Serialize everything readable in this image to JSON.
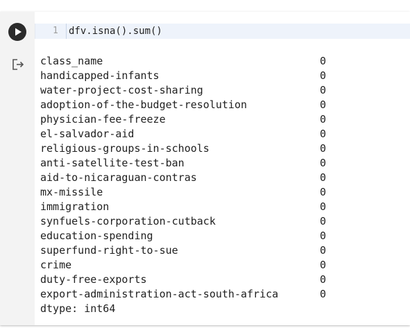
{
  "code_cell": {
    "line_number": "1",
    "code": "dfv.isna().sum()",
    "run_button_icon": "play-icon"
  },
  "output": {
    "icon": "output-redirect-icon",
    "rows": [
      {
        "name": "class_name",
        "value": "0"
      },
      {
        "name": "handicapped-infants",
        "value": "0"
      },
      {
        "name": "water-project-cost-sharing",
        "value": "0"
      },
      {
        "name": "adoption-of-the-budget-resolution",
        "value": "0"
      },
      {
        "name": "physician-fee-freeze",
        "value": "0"
      },
      {
        "name": "el-salvador-aid",
        "value": "0"
      },
      {
        "name": "religious-groups-in-schools",
        "value": "0"
      },
      {
        "name": "anti-satellite-test-ban",
        "value": "0"
      },
      {
        "name": "aid-to-nicaraguan-contras",
        "value": "0"
      },
      {
        "name": "mx-missile",
        "value": "0"
      },
      {
        "name": "immigration",
        "value": "0"
      },
      {
        "name": "synfuels-corporation-cutback",
        "value": "0"
      },
      {
        "name": "education-spending",
        "value": "0"
      },
      {
        "name": "superfund-right-to-sue",
        "value": "0"
      },
      {
        "name": "crime",
        "value": "0"
      },
      {
        "name": "duty-free-exports",
        "value": "0"
      },
      {
        "name": "export-administration-act-south-africa",
        "value": "0"
      }
    ],
    "dtype_line": "dtype: int64"
  },
  "colors": {
    "code_background": "#eef3fb",
    "gutter_background": "#f3f3f3",
    "run_button": "#2b2b2b",
    "text": "#212121"
  }
}
